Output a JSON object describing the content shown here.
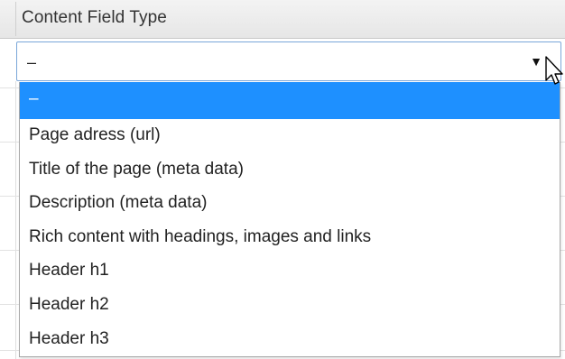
{
  "field": {
    "label": "Content Field Type"
  },
  "select": {
    "value": "–",
    "arrow_icon": "triangle-down-icon"
  },
  "options": [
    {
      "label": "–",
      "selected": true
    },
    {
      "label": "Page adress (url)",
      "selected": false
    },
    {
      "label": "Title of the page (meta data)",
      "selected": false
    },
    {
      "label": "Description (meta data)",
      "selected": false
    },
    {
      "label": "Rich content with headings, images and links",
      "selected": false
    },
    {
      "label": "Header h1",
      "selected": false
    },
    {
      "label": "Header h2",
      "selected": false
    },
    {
      "label": "Header h3",
      "selected": false
    }
  ],
  "colors": {
    "highlight": "#1e90ff",
    "select_border": "#7aa7d9",
    "header_bg": "#ececec"
  }
}
